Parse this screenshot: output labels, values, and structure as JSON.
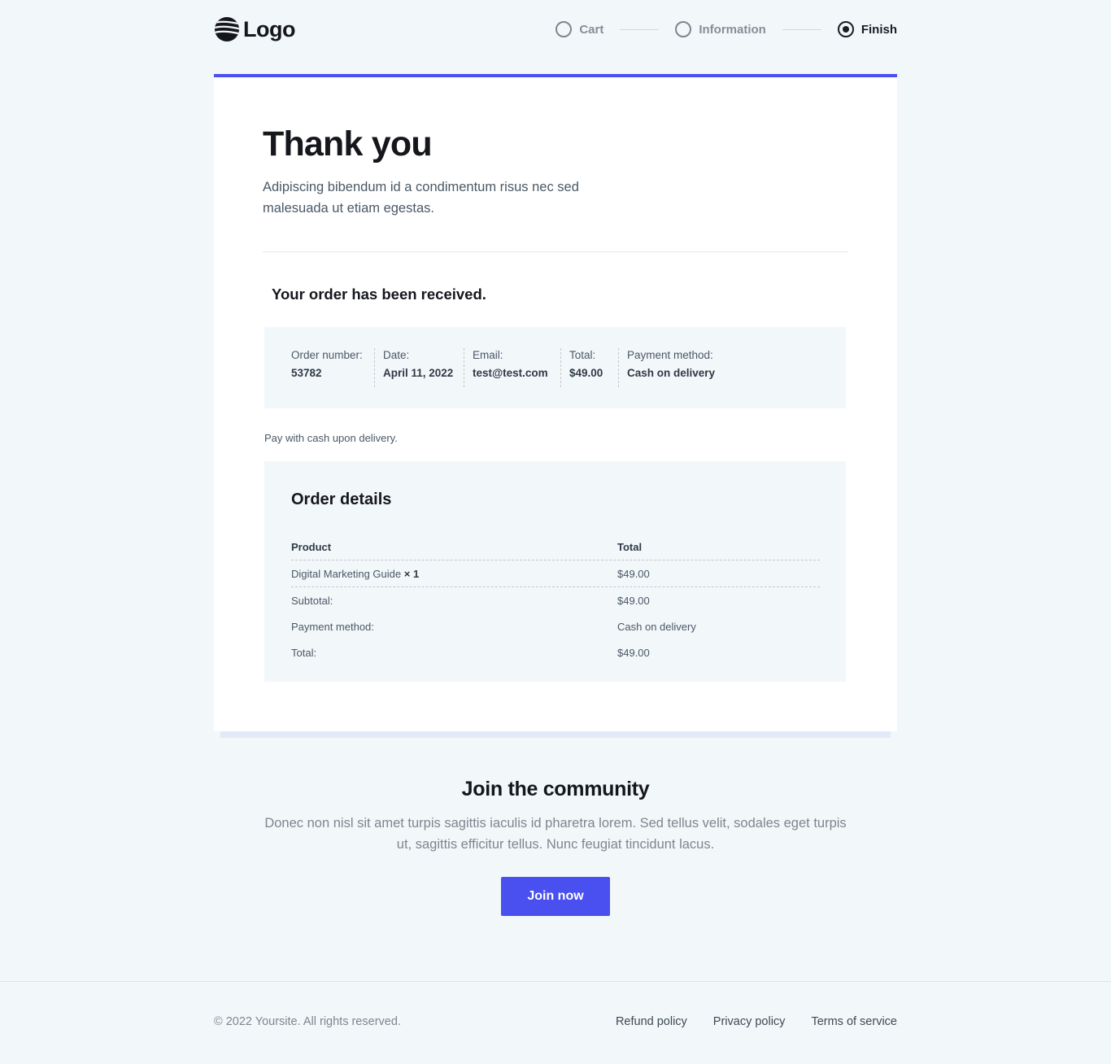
{
  "header": {
    "logo_text": "Logo",
    "steps": [
      {
        "label": "Cart",
        "state": "pending"
      },
      {
        "label": "Information",
        "state": "pending"
      },
      {
        "label": "Finish",
        "state": "active"
      }
    ]
  },
  "confirmation": {
    "title": "Thank you",
    "lead": "Adipiscing bibendum id a condimentum risus nec sed malesuada ut etiam egestas.",
    "received": "Your order has been received.",
    "summary": {
      "order_number_label": "Order number:",
      "order_number": "53782",
      "date_label": "Date:",
      "date": "April 11, 2022",
      "email_label": "Email:",
      "email": "test@test.com",
      "total_label": "Total:",
      "total": "$49.00",
      "payment_label": "Payment method:",
      "payment": "Cash on delivery"
    },
    "pay_note": "Pay with cash upon delivery.",
    "details": {
      "title": "Order details",
      "col_product": "Product",
      "col_total": "Total",
      "item_name": "Digital Marketing Guide",
      "item_qty": "× 1",
      "item_total": "$49.00",
      "subtotal_label": "Subtotal:",
      "subtotal": "$49.00",
      "payment_label": "Payment method:",
      "payment": "Cash on delivery",
      "total_label": "Total:",
      "total": "$49.00"
    }
  },
  "community": {
    "title": "Join the community",
    "text": "Donec non nisl sit amet turpis sagittis iaculis id pharetra lorem. Sed tellus velit, sodales eget turpis ut, sagittis efficitur tellus. Nunc feugiat tincidunt lacus.",
    "button": "Join now"
  },
  "footer": {
    "copyright": "© 2022 Yoursite. All rights reserved.",
    "links": [
      "Refund policy",
      "Privacy policy",
      "Terms of service"
    ]
  },
  "colors": {
    "accent": "#4a4ff0",
    "background": "#f2f7fa",
    "text_dark": "#15171c",
    "text_muted": "#7d868f"
  }
}
